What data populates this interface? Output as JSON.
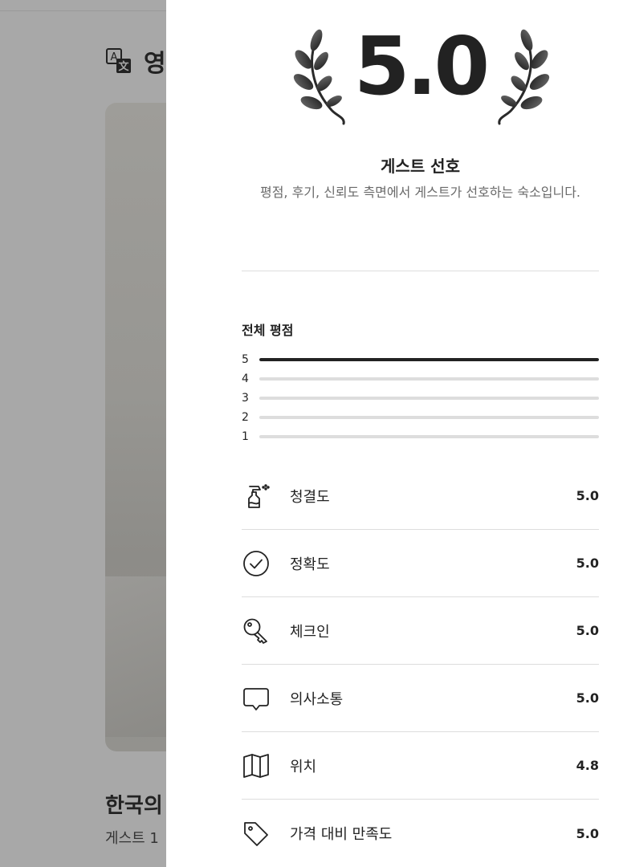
{
  "background": {
    "translate_label": "영",
    "listing_title": "한국의",
    "listing_sub": "게스트 1"
  },
  "hero": {
    "rating": "5.0",
    "badge_title": "게스트 선호",
    "badge_desc": "평점, 후기, 신뢰도 측면에서 게스트가 선호하는 숙소입니다."
  },
  "overall": {
    "title": "전체 평점",
    "distribution": [
      {
        "label": "5",
        "fraction": 1.0
      },
      {
        "label": "4",
        "fraction": 0.0
      },
      {
        "label": "3",
        "fraction": 0.0
      },
      {
        "label": "2",
        "fraction": 0.0
      },
      {
        "label": "1",
        "fraction": 0.0
      }
    ]
  },
  "categories": [
    {
      "label": "청결도",
      "value": "5.0",
      "icon": "spray-bottle-icon"
    },
    {
      "label": "정확도",
      "value": "5.0",
      "icon": "check-circle-icon"
    },
    {
      "label": "체크인",
      "value": "5.0",
      "icon": "key-icon"
    },
    {
      "label": "의사소통",
      "value": "5.0",
      "icon": "chat-bubble-icon"
    },
    {
      "label": "위치",
      "value": "4.8",
      "icon": "map-icon"
    },
    {
      "label": "가격 대비 만족도",
      "value": "5.0",
      "icon": "price-tag-icon"
    }
  ]
}
